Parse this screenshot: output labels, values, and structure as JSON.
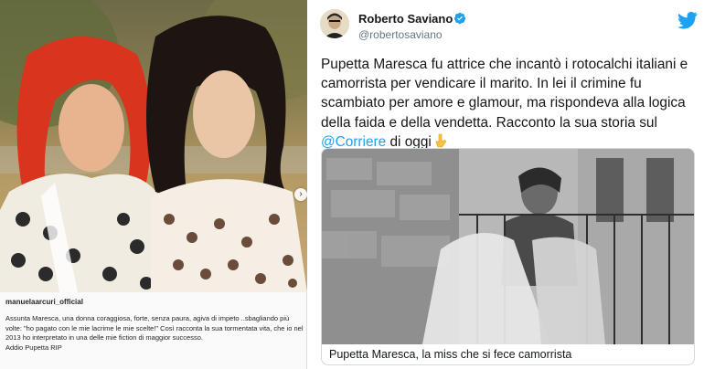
{
  "instagram": {
    "username": "manuelaarcuri_official",
    "caption": "Assunta Maresca, una donna coraggiosa, forte, senza paura, agiva di impeto ..sbagliando più volte: \"ho pagato con le mie lacrime le mie scelte!\" Così racconta la sua tormentata vita, che io nel 2013 ho interpretato in una delle mie fiction di maggior successo.",
    "signoff": "Addio Pupetta RIP",
    "next_icon": "chevron-right-icon"
  },
  "tweet": {
    "display_name": "Roberto Saviano",
    "handle": "@robertosaviano",
    "verified_icon": "verified-badge-icon",
    "logo_icon": "twitter-bird-icon",
    "text": "Pupetta Maresca fu attrice che incantò i rotocalchi italiani e camorrista per vendicare il marito. In lei il crimine fu scambiato per amore e glamour, ma rispondeva alla logica della faida e della vendetta. Racconto la sua storia sul ",
    "mention": "@Corriere",
    "text_tail": " di oggi",
    "emoji_icon": "pointing-down-hand-icon",
    "card_title": "Pupetta Maresca, la miss che si fece camorrista"
  },
  "colors": {
    "twitter_blue": "#1da1f2",
    "text_dark": "#14171a",
    "text_muted": "#657786"
  }
}
